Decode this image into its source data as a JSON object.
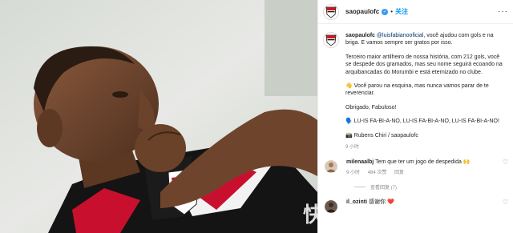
{
  "post": {
    "username": "saopaulofc",
    "follow_label": "关注",
    "more_label": "···",
    "caption": {
      "username": "saopaulofc",
      "mention": "@luisfabianooficial",
      "line1_rest": ", você ajudou com gols e na briga. E vamos sempre ser gratos por isso.",
      "para2": "Terceiro maior artilheiro de nossa história, com 212 gols, você se despede dos gramados, mas seu nome seguirá ecoando na arquibancadas do Morumbi e está eternizado no clube.",
      "para3": "👋 Você parou na esquina, mas nunca vamos parar de te reverenciar.",
      "para4": "Obrigado, Fabuloso!",
      "para5": "🗣️ LU-IS FA-BI-A-NO, LU-IS FA-BI-A-NO, LU-IS FA-BI-A-NO!",
      "para6": "📸 Rubens Chiri / saopaulofc",
      "time": "9 小时"
    }
  },
  "comments": [
    {
      "username": "milenaalbj",
      "text": "Tem que ter um jogo de despedida 🙌",
      "time": "9 小时",
      "likes": "484 次赞",
      "reply": "回复",
      "view_replies": "查看回复 (7)"
    },
    {
      "username": "il_ozinti",
      "text": "感谢你 ❤️",
      "time": "",
      "likes": "",
      "reply": ""
    }
  ],
  "watermark": "快",
  "colors": {
    "link": "#0095f6",
    "mention": "#00376b",
    "muted": "#8e8e8e",
    "club_red": "#d7121b"
  }
}
